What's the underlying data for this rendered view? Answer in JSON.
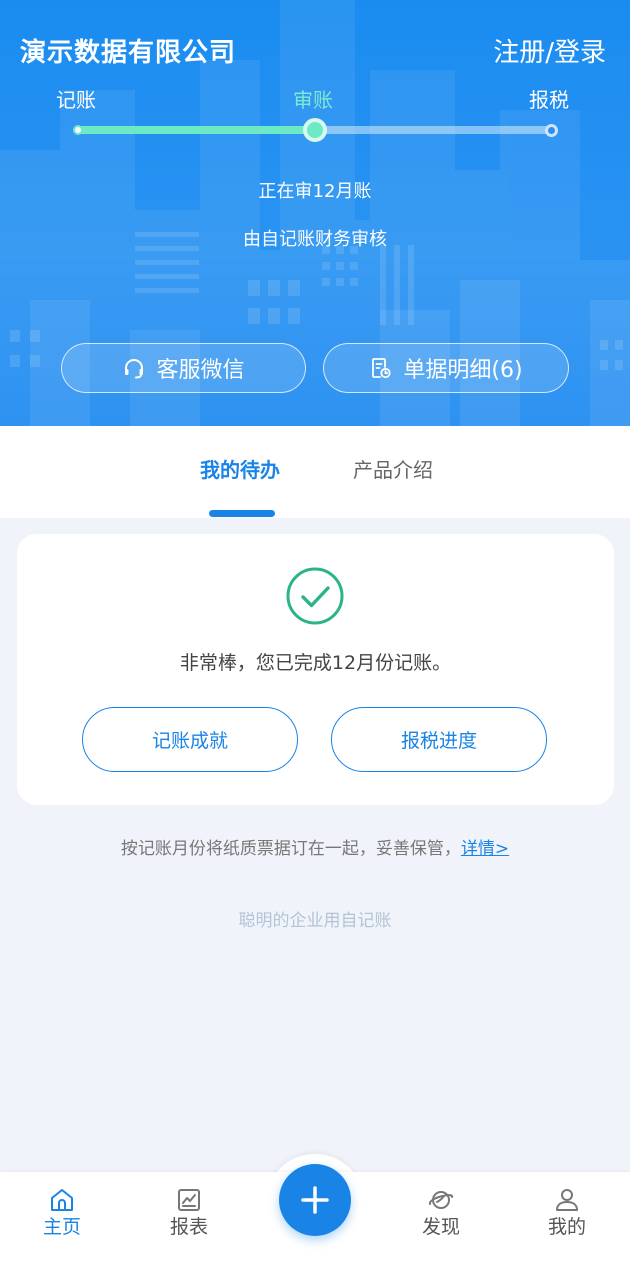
{
  "header": {
    "company": "演示数据有限公司",
    "login": "注册/登录",
    "steps": [
      "记账",
      "审账",
      "报税"
    ],
    "progress_percent": 50,
    "status_line1": "正在审12月账",
    "status_line2": "由自记账财务审核",
    "btn_wechat": "客服微信",
    "btn_docs": "单据明细(6)"
  },
  "tabs": {
    "active": "我的待办",
    "other": "产品介绍"
  },
  "card": {
    "message": "非常棒，您已完成12月份记账。",
    "btn_achievement": "记账成就",
    "btn_tax": "报税进度"
  },
  "note": {
    "text": "按记账月份将纸质票据订在一起，妥善保管，",
    "link": "详情>"
  },
  "slogan": "聪明的企业用自记账",
  "nav": {
    "home": "主页",
    "reports": "报表",
    "discover": "发现",
    "mine": "我的"
  },
  "colors": {
    "primary": "#1a84e6",
    "progress": "#6ee9c6",
    "check": "#2bb38a"
  }
}
